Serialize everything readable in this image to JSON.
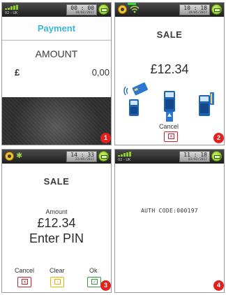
{
  "screens": [
    {
      "status": {
        "carrier": "02 - UK",
        "time": "00 : 00",
        "date": "18/02/2017"
      },
      "header_title": "Payment",
      "amount_label": "AMOUNT",
      "currency_symbol": "£",
      "amount_value": "0,00",
      "step": "1"
    },
    {
      "status": {
        "time": "10 : 18",
        "date": "19/05/2017"
      },
      "title": "SALE",
      "amount": "£12.34",
      "cancel_label": "Cancel",
      "step": "2"
    },
    {
      "status": {
        "time": "14 : 33",
        "date": "22/05/2017"
      },
      "title": "SALE",
      "amount_label": "Amount",
      "amount": "£12.34",
      "prompt": "Enter PIN",
      "cancel_label": "Cancel",
      "clear_label": "Clear",
      "ok_label": "Ok",
      "step": "3"
    },
    {
      "status": {
        "carrier": "02 - UK",
        "time": "11 : 18",
        "date": "03/02/2017"
      },
      "auth_code": "AUTH CODE:000197",
      "step": "4"
    }
  ],
  "colors": {
    "payment_header": "#39b6d8",
    "marker_red": "#e32020",
    "battery_green": "#8bd12a",
    "cancel_red": "#d81e2a",
    "clear_yellow": "#e6b400",
    "ok_green": "#2e9a3a"
  },
  "icons": {
    "signal": "signal-bars-icon",
    "battery": "battery-icon",
    "wifi": "wifi-icon",
    "bluetooth": "bluetooth-icon",
    "wheel": "status-wheel-icon",
    "contactless_card": "contactless-card-icon",
    "insert_card": "insert-card-icon",
    "swipe_card": "swipe-card-icon"
  }
}
